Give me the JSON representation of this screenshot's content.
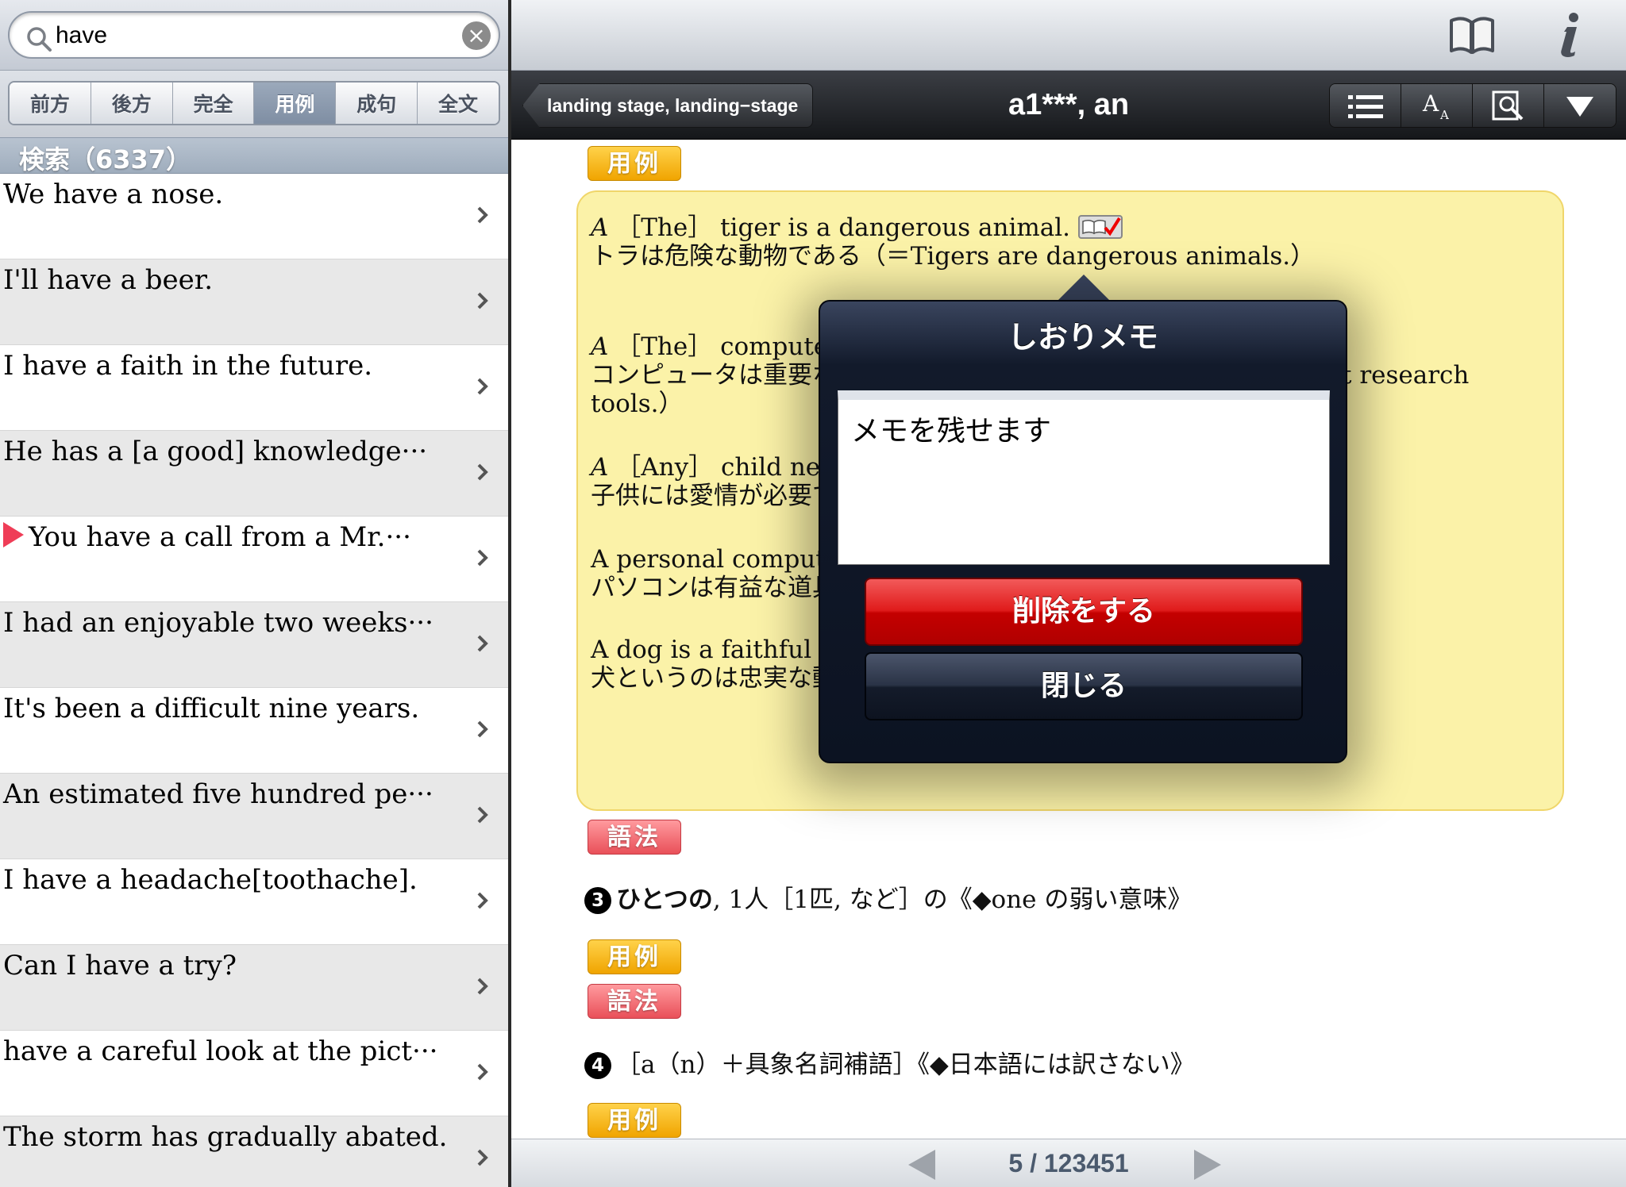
{
  "search": {
    "query": "have"
  },
  "segments": [
    {
      "label": "前方"
    },
    {
      "label": "後方"
    },
    {
      "label": "完全"
    },
    {
      "label": "用例",
      "active": true
    },
    {
      "label": "成句"
    },
    {
      "label": "全文"
    }
  ],
  "results_header": "検索（6337）",
  "results": [
    {
      "text": "We have a nose."
    },
    {
      "text": "I'll have a beer."
    },
    {
      "text": "I have a faith in the future."
    },
    {
      "text": "He has a [a good] knowledge···"
    },
    {
      "text": "You have a call from a Mr.···",
      "marked": true
    },
    {
      "text": "I had an enjoyable two weeks···"
    },
    {
      "text": "It's been a difficult nine years."
    },
    {
      "text": "An estimated five hundred pe···"
    },
    {
      "text": "I have a headache[toothache]."
    },
    {
      "text": "Can I have a try?"
    },
    {
      "text": "have a careful look at the pict···"
    },
    {
      "text": "The storm has gradually abated."
    }
  ],
  "nav": {
    "back_label": "landing stage, landing−stage",
    "title": "a1***, an",
    "tools": [
      "list-icon",
      "font-size-icon",
      "zoom-search-icon",
      "dropdown-icon"
    ]
  },
  "top_icons": [
    "book-icon",
    "info-icon"
  ],
  "content": {
    "tag_yourei": "用例",
    "tag_gohou": "語法",
    "examples": [
      {
        "a": "A",
        "en": "［The］ tiger is a dangerous animal.",
        "ja": "トラは危険な動物である（＝Tigers are dangerous animals.）"
      },
      {
        "a": "A",
        "en": "［The］ computer is an important research tool.",
        "ja": "コンピュータは重要な研究道具です（＝Computers are important research",
        "ja2": "tools.）"
      },
      {
        "a": "A",
        "en": "［Any］ child needs love.",
        "ja": "子供には愛情が必要である"
      },
      {
        "en": "A personal computer is a useful tool.",
        "ja": "パソコンは有益な道具です"
      },
      {
        "en": "A dog is a faithful animal.",
        "ja": "犬というのは忠実な動物です"
      }
    ],
    "sense3": {
      "num": "3",
      "head": "ひとつの",
      "rest": ", 1人［1匹, など］の《◆one の弱い意味》"
    },
    "sense4": {
      "num": "4",
      "rest": "［a（n）＋具象名詞補語］《◆日本語には訳さない》"
    }
  },
  "pagination": {
    "text": "5 / 123451"
  },
  "popover": {
    "title": "しおりメモ",
    "memo": "メモを残せます",
    "delete_label": "削除をする",
    "close_label": "閉じる"
  },
  "colors": {
    "accent_red": "#e01b1b",
    "highlight_yellow": "#fbf2a8",
    "tag_orange": "#f0a400",
    "tag_pink": "#e95059"
  }
}
